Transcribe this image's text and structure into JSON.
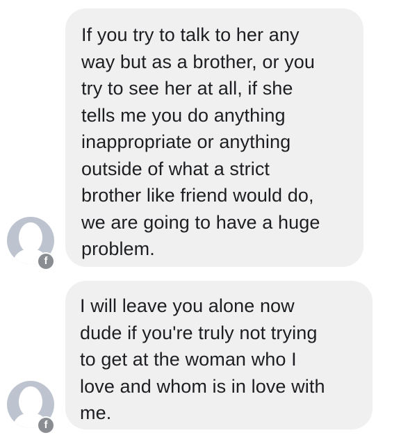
{
  "messages": [
    {
      "lines": [
        "If you try to talk to her any",
        "way but as a brother, or you",
        "try to see her at all, if she",
        "tells me you do anything",
        "inappropriate or anything",
        "outside of what a strict",
        "brother like friend would do,",
        "we are going to have a huge",
        "problem."
      ]
    },
    {
      "lines": [
        "I will leave you alone now",
        "dude if you're truly not trying",
        "to get at the woman who I",
        "love and whom is in love with",
        "me."
      ]
    }
  ],
  "badge": {
    "icon": "facebook-icon",
    "glyph": "f"
  },
  "colors": {
    "bubble": "#f0f0f0",
    "text": "#1c1e21",
    "avatar": "#bec4cf",
    "badge": "#8a8d91"
  }
}
